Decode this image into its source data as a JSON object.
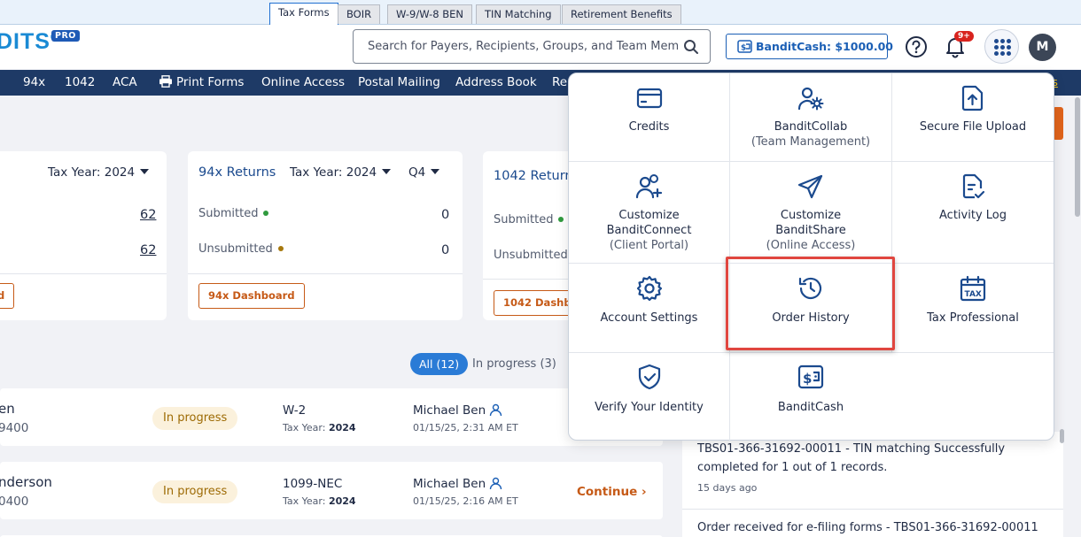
{
  "top_tabs": [
    "Tax Forms",
    "BOIR",
    "W-9/W-8 BEN",
    "TIN Matching",
    "Retirement Benefits"
  ],
  "brand": {
    "logo_text": "DITS",
    "reg": "®",
    "pro_badge": "PRO"
  },
  "search": {
    "placeholder": "Search for Payers, Recipients, Groups, and Team Members"
  },
  "bandit_cash_button": "BanditCash: $1000.00",
  "notifications_badge": "9+",
  "avatar_initial": "M",
  "nav": [
    "94x",
    "1042",
    "ACA",
    "Print Forms",
    "Online Access",
    "Postal Mailing",
    "Address Book",
    "Re"
  ],
  "nav_right_link": "ns",
  "cards": {
    "first": {
      "tax_year": "Tax Year: 2024",
      "values": [
        "62",
        "62"
      ],
      "button": "d"
    },
    "x94": {
      "title": "94x Returns",
      "tax_year": "Tax Year: 2024",
      "quarter": "Q4",
      "submitted_label": "Submitted",
      "submitted_value": "0",
      "unsubmitted_label": "Unsubmitted",
      "unsubmitted_value": "0",
      "button": "94x Dashboard"
    },
    "r1042": {
      "title": "1042 Return",
      "submitted_label": "Submitted",
      "unsubmitted_label": "Unsubmitted",
      "button": "1042 Dashbo"
    }
  },
  "filters": {
    "all": "All (12)",
    "in_progress": "In progress (3)"
  },
  "rows": [
    {
      "name": "en",
      "number": "9400",
      "status": "In progress",
      "form": "W-2",
      "tax_year_label": "Tax Year:",
      "tax_year": "2024",
      "user": "Michael Ben",
      "datetime": "01/15/25, 2:31 AM ET",
      "action": ""
    },
    {
      "name": "nderson",
      "number": "0400",
      "status": "In progress",
      "form": "1099-NEC",
      "tax_year_label": "Tax Year:",
      "tax_year": "2024",
      "user": "Michael Ben",
      "datetime": "01/15/25, 2:16 AM ET",
      "action": "Continue"
    }
  ],
  "notifications": {
    "item1": "TBS01-366-31692-00011 - TIN matching Successfully completed for 1 out of 1 records.",
    "item1_ago": "15 days ago",
    "item2": "Order received for e-filing forms - TBS01-366-31692-00011"
  },
  "apps_menu": {
    "items": [
      {
        "label": "Credits",
        "sub": "",
        "icon": "credit-card-icon"
      },
      {
        "label": "BanditCollab",
        "sub": "(Team Management)",
        "icon": "user-gear-icon"
      },
      {
        "label": "Secure File Upload",
        "sub": "",
        "icon": "file-upload-icon"
      },
      {
        "label": "Customize BanditConnect",
        "sub": "(Client Portal)",
        "icon": "users-plus-icon"
      },
      {
        "label": "Customize BanditShare",
        "sub": "(Online Access)",
        "icon": "send-icon"
      },
      {
        "label": "Activity Log",
        "sub": "",
        "icon": "document-check-icon"
      },
      {
        "label": "Account Settings",
        "sub": "",
        "icon": "gear-icon"
      },
      {
        "label": "Order History",
        "sub": "",
        "icon": "history-icon"
      },
      {
        "label": "Tax Professional",
        "sub": "",
        "icon": "tax-calendar-icon"
      },
      {
        "label": "Verify Your Identity",
        "sub": "",
        "icon": "shield-check-icon"
      },
      {
        "label": "BanditCash",
        "sub": "",
        "icon": "bandit-cash-icon"
      }
    ],
    "highlighted": "Order History"
  },
  "colors": {
    "nav_bg": "#1e3a66",
    "accent": "#1b5fb5",
    "orange": "#c65a17",
    "highlight": "#e0463f"
  }
}
